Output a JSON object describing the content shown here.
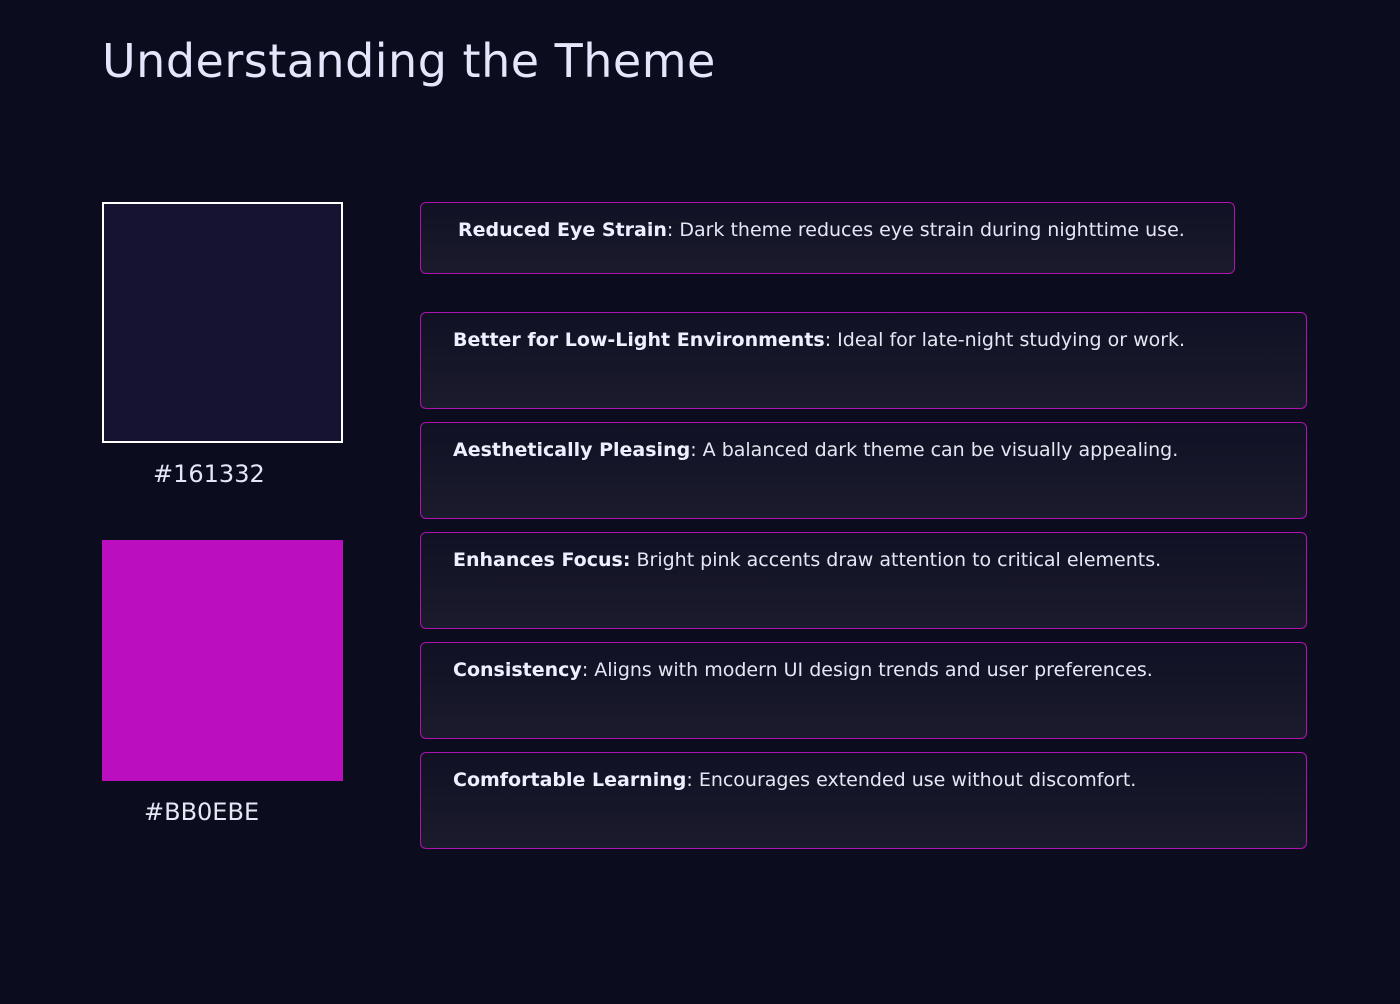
{
  "title": "Understanding the Theme",
  "colors": [
    {
      "hex": "#161332",
      "label": "#161332"
    },
    {
      "hex": "#BB0EBE",
      "label": "#BB0EBE"
    }
  ],
  "benefits": [
    {
      "term": "Reduced Eye Strain",
      "sep": ": ",
      "text": "Dark theme reduces eye strain during nighttime use."
    },
    {
      "term": "Better for Low-Light Environments",
      "sep": ": ",
      "text": "Ideal for late-night studying or work."
    },
    {
      "term": "Aesthetically Pleasing",
      "sep": ": ",
      "text": "A balanced dark theme can be visually appealing."
    },
    {
      "term": "Enhances Focus:",
      "sep": " ",
      "text": "Bright pink accents draw attention to critical elements."
    },
    {
      "term": "Consistency",
      "sep": ": ",
      "text": "Aligns with modern UI design trends and user preferences."
    },
    {
      "term": "Comfortable Learning",
      "sep": ": ",
      "text": "Encourages extended use without discomfort."
    }
  ]
}
